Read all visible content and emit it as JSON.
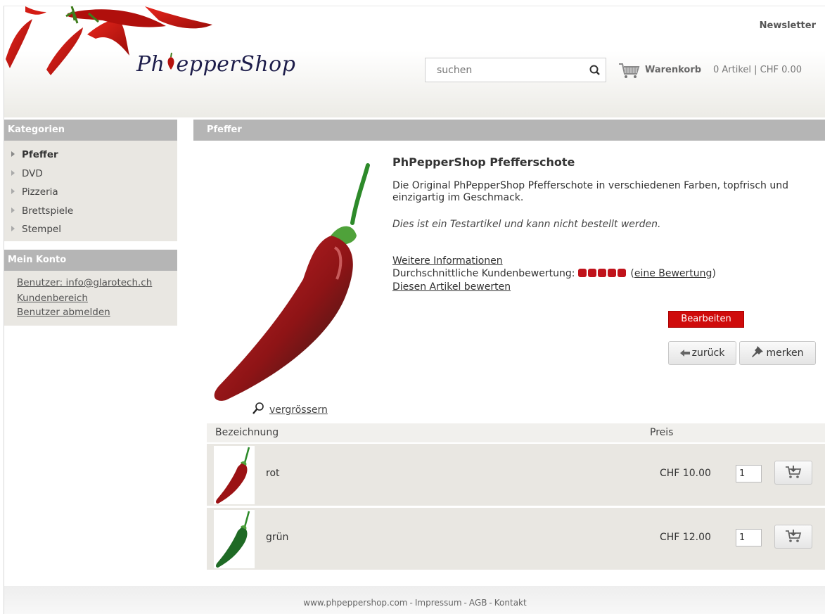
{
  "header": {
    "logo_text": "PhPepperShop",
    "logo_left": "Ph",
    "logo_right": "epperShop",
    "newsletter_label": "Newsletter",
    "search_placeholder": "suchen",
    "cart_label": "Warenkorb",
    "cart_summary": "0 Artikel | CHF 0.00"
  },
  "sidebar": {
    "categories_title": "Kategorien",
    "categories": [
      {
        "label": "Pfeffer",
        "active": true
      },
      {
        "label": "DVD",
        "active": false
      },
      {
        "label": "Pizzeria",
        "active": false
      },
      {
        "label": "Brettspiele",
        "active": false
      },
      {
        "label": "Stempel",
        "active": false
      }
    ],
    "account_title": "Mein Konto",
    "account_links": [
      {
        "label": "Benutzer: info@glarotech.ch"
      },
      {
        "label": "Kundenbereich"
      },
      {
        "label": "Benutzer abmelden"
      }
    ]
  },
  "main": {
    "section_title": "Pfeffer",
    "product": {
      "title": "PhPepperShop Pfefferschote",
      "description": "Die Original PhPepperShop Pfefferschote in verschiedenen Farben, topfrisch und einzigartig im Geschmack.",
      "note": "Dies ist ein Testartikel und kann nicht bestellt werden.",
      "more_info_label": "Weitere Informationen",
      "rating_prefix": "Durchschnittliche Kundenbewertung:",
      "rating_value": 5,
      "rating_max": 5,
      "rating_count_label": "eine Bewertung",
      "rate_link_label": "Diesen Artikel bewerten",
      "zoom_label": "vergrössern"
    },
    "buttons": {
      "edit_label": "Bearbeiten",
      "back_label": "zurück",
      "bookmark_label": "merken"
    },
    "table": {
      "col_name": "Bezeichnung",
      "col_price": "Preis",
      "rows": [
        {
          "name": "rot",
          "price": "CHF 10.00",
          "qty": "1"
        },
        {
          "name": "grün",
          "price": "CHF 12.00",
          "qty": "1"
        }
      ]
    }
  },
  "footer": {
    "links": [
      "www.phpeppershop.com",
      "Impressum",
      "AGB",
      "Kontakt"
    ]
  },
  "colors": {
    "accent_red": "#cf0b0b",
    "bar_grey": "#b5b5b5",
    "panel_beige": "#e9e7e2"
  }
}
